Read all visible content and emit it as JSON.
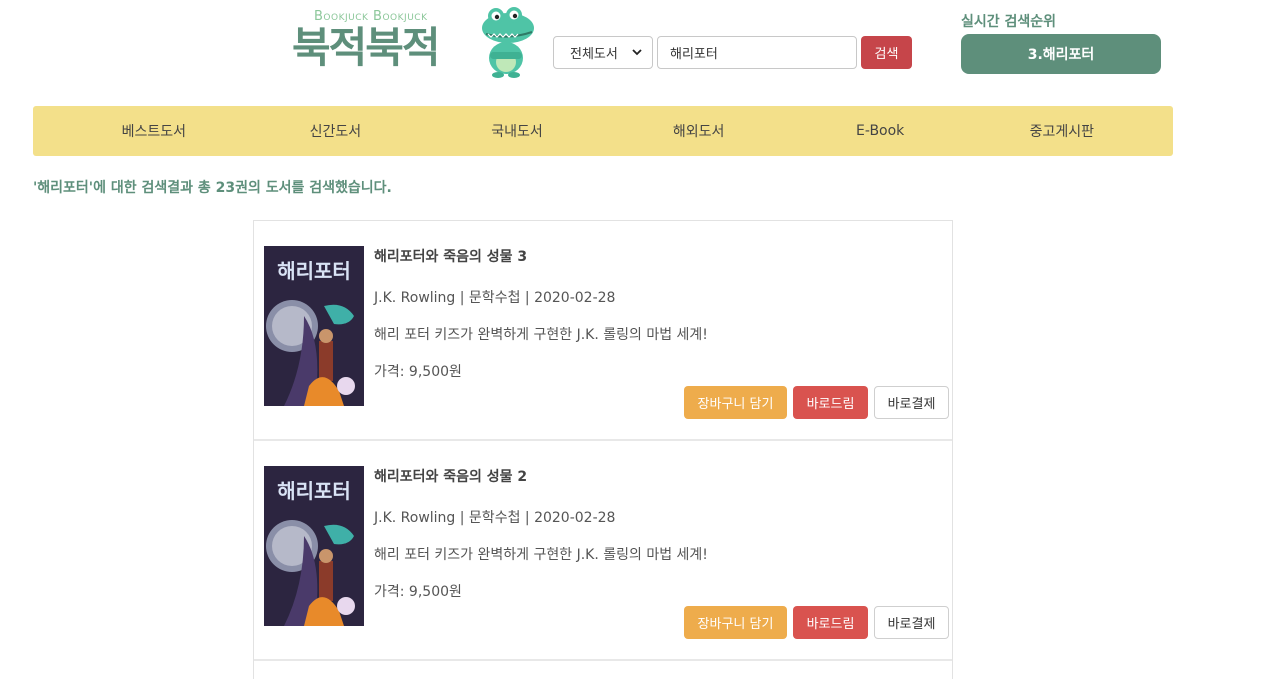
{
  "header": {
    "logo_sub": "Bookjuck Bookjuck",
    "logo_main": "북적북적",
    "mascot_icon": "crocodile-mascot-icon"
  },
  "search": {
    "category": "전체도서",
    "query": "해리포터",
    "button": "검색"
  },
  "ranking": {
    "title": "실시간 검색순위",
    "current": "3.해리포터"
  },
  "nav": {
    "items": [
      "베스트도서",
      "신간도서",
      "국내도서",
      "해외도서",
      "E-Book",
      "중고게시판"
    ]
  },
  "result_message": "'해리포터'에 대한 검색결과 총 23권의 도서를 검색했습니다.",
  "books": [
    {
      "title": "해리포터와 죽음의 성물 3",
      "meta": "J.K. Rowling | 문학수첩 | 2020-02-28",
      "desc": "해리 포터 키즈가 완벽하게 구현한 J.K. 롤링의 마법 세계!",
      "price": "가격: 9,500원",
      "cover_title": "해리포터",
      "buttons": {
        "cart": "장바구니 담기",
        "borrow": "바로드림",
        "buy": "바로결제"
      }
    },
    {
      "title": "해리포터와 죽음의 성물 2",
      "meta": "J.K. Rowling | 문학수첩 | 2020-02-28",
      "desc": "해리 포터 키즈가 완벽하게 구현한 J.K. 롤링의 마법 세계!",
      "price": "가격: 9,500원",
      "cover_title": "해리포터",
      "buttons": {
        "cart": "장바구니 담기",
        "borrow": "바로드림",
        "buy": "바로결제"
      }
    }
  ],
  "colors": {
    "brand_green": "#5e8f7b",
    "nav_yellow": "#f3e08a",
    "search_red": "#c6454a",
    "cart_orange": "#eeac4c",
    "borrow_red": "#d9534f"
  }
}
